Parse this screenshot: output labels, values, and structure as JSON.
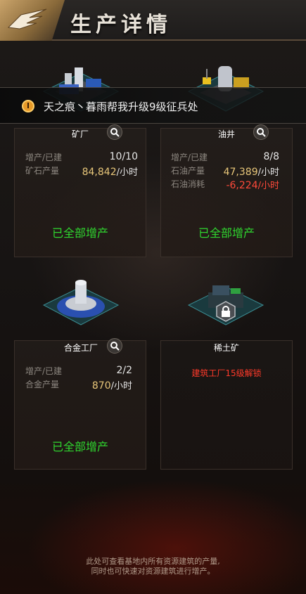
{
  "header": {
    "title": "生产详情"
  },
  "notice": {
    "text": "天之痕丶暮雨帮我升级9级征兵处"
  },
  "cards": [
    {
      "name": "矿厂",
      "stats": [
        {
          "label": "增产/已建",
          "value": "10/10",
          "unit": ""
        },
        {
          "label": "矿石产量",
          "value": "84,842",
          "unit": "/小时"
        }
      ],
      "status": "已全部增产"
    },
    {
      "name": "油井",
      "stats": [
        {
          "label": "增产/已建",
          "value": "8/8",
          "unit": ""
        },
        {
          "label": "石油产量",
          "value": "47,389",
          "unit": "/小时"
        },
        {
          "label": "石油消耗",
          "value": "-6,224",
          "unit": "/小时"
        }
      ],
      "status": "已全部增产"
    },
    {
      "name": "合金工厂",
      "stats": [
        {
          "label": "增产/已建",
          "value": "2/2",
          "unit": ""
        },
        {
          "label": "合金产量",
          "value": "870",
          "unit": "/小时"
        }
      ],
      "status": "已全部增产"
    },
    {
      "name": "稀土矿",
      "lock_text": "建筑工厂15级解锁"
    }
  ],
  "footer": {
    "line1": "此处可查看基地内所有资源建筑的产量,",
    "line2": "同时也可快速对资源建筑进行增产。"
  },
  "colors": {
    "green": "#2fd62f",
    "gold": "#e8c77a",
    "red": "#ff4a3a"
  }
}
